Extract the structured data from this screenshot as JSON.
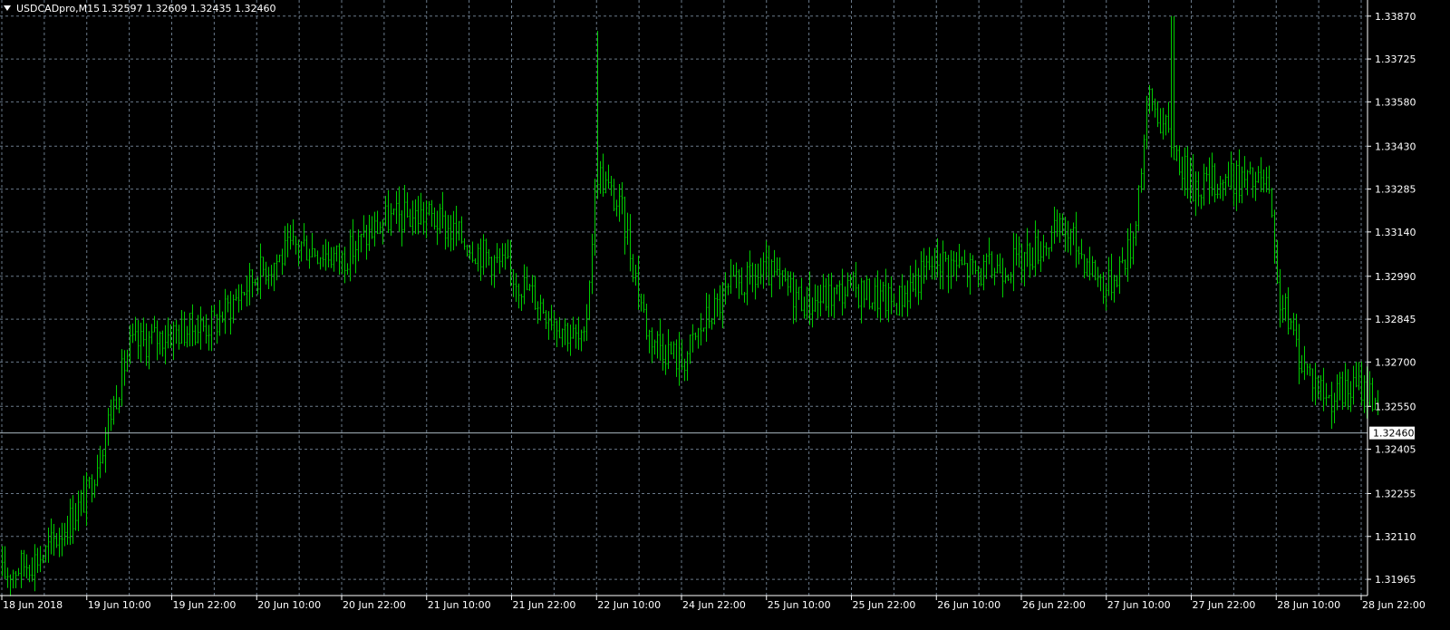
{
  "header": {
    "menu_icon": "triangle-down-icon",
    "symbol": "USDCADpro,M15",
    "ohlc": "1.32597 1.32609 1.32435 1.32460"
  },
  "colors": {
    "background": "#000000",
    "bars": "#00cc00",
    "grid": "#6a7a8a",
    "axis_text": "#ffffff",
    "price_line": "#aab8c0",
    "price_label_bg": "#ffffff",
    "price_label_text": "#000000"
  },
  "chart_data": {
    "type": "ohlc_bars",
    "timeframe": "M15",
    "symbol": "USDCADpro",
    "ylim": [
      1.3191,
      1.339
    ],
    "y_ticks": [
      "1.31965",
      "1.32110",
      "1.32255",
      "1.32405",
      "1.32550",
      "1.32700",
      "1.32845",
      "1.32990",
      "1.33140",
      "1.33285",
      "1.33430",
      "1.33580",
      "1.33725",
      "1.33870"
    ],
    "x_ticks": [
      "18 Jun 2018",
      "19 Jun 10:00",
      "19 Jun 22:00",
      "20 Jun 10:00",
      "20 Jun 22:00",
      "21 Jun 10:00",
      "21 Jun 22:00",
      "22 Jun 10:00",
      "24 Jun 22:00",
      "25 Jun 10:00",
      "25 Jun 22:00",
      "26 Jun 10:00",
      "26 Jun 22:00",
      "27 Jun 10:00",
      "27 Jun 22:00",
      "28 Jun 10:00",
      "28 Jun 22:00"
    ],
    "current_price": "1.32460",
    "close_path": [
      {
        "t": 0.0,
        "price": 1.3198
      },
      {
        "t": 0.5,
        "price": 1.3205
      },
      {
        "t": 1.0,
        "price": 1.3225
      },
      {
        "t": 1.5,
        "price": 1.3275
      },
      {
        "t": 2.0,
        "price": 1.328
      },
      {
        "t": 2.5,
        "price": 1.3283
      },
      {
        "t": 3.0,
        "price": 1.33
      },
      {
        "t": 3.5,
        "price": 1.331
      },
      {
        "t": 4.0,
        "price": 1.3305
      },
      {
        "t": 4.5,
        "price": 1.3318
      },
      {
        "t": 5.0,
        "price": 1.332
      },
      {
        "t": 5.5,
        "price": 1.331
      },
      {
        "t": 6.0,
        "price": 1.33
      },
      {
        "t": 6.5,
        "price": 1.3285
      },
      {
        "t": 6.85,
        "price": 1.3275
      },
      {
        "t": 7.0,
        "price": 1.3335
      },
      {
        "t": 7.3,
        "price": 1.332
      },
      {
        "t": 7.6,
        "price": 1.328
      },
      {
        "t": 8.0,
        "price": 1.327
      },
      {
        "t": 8.3,
        "price": 1.3285
      },
      {
        "t": 8.6,
        "price": 1.3295
      },
      {
        "t": 9.0,
        "price": 1.33
      },
      {
        "t": 9.5,
        "price": 1.329
      },
      {
        "t": 10.0,
        "price": 1.3295
      },
      {
        "t": 10.5,
        "price": 1.329
      },
      {
        "t": 11.0,
        "price": 1.3305
      },
      {
        "t": 11.5,
        "price": 1.33
      },
      {
        "t": 12.0,
        "price": 1.3305
      },
      {
        "t": 12.5,
        "price": 1.3315
      },
      {
        "t": 13.0,
        "price": 1.3295
      },
      {
        "t": 13.3,
        "price": 1.331
      },
      {
        "t": 13.5,
        "price": 1.336
      },
      {
        "t": 14.0,
        "price": 1.333
      },
      {
        "t": 14.5,
        "price": 1.3332
      },
      {
        "t": 14.9,
        "price": 1.333
      },
      {
        "t": 15.0,
        "price": 1.3295
      },
      {
        "t": 15.3,
        "price": 1.327
      },
      {
        "t": 15.6,
        "price": 1.3258
      },
      {
        "t": 16.0,
        "price": 1.3262
      },
      {
        "t": 16.25,
        "price": 1.3256
      }
    ],
    "extreme_highs": [
      {
        "t": 7.0,
        "price": 1.3382
      },
      {
        "t": 13.78,
        "price": 1.3387
      }
    ]
  }
}
